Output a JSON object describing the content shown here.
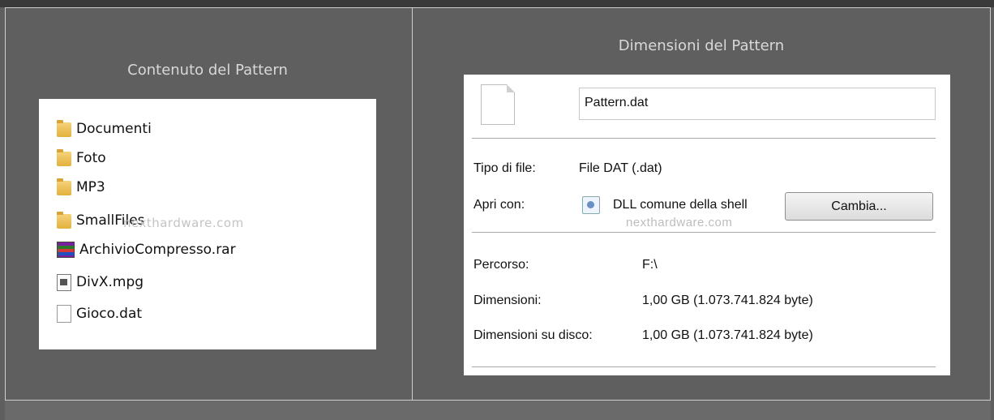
{
  "left_panel": {
    "title": "Contenuto del Pattern",
    "files": [
      {
        "name": "Documenti",
        "icon": "folder-icon"
      },
      {
        "name": "Foto",
        "icon": "folder-icon"
      },
      {
        "name": "MP3",
        "icon": "folder-icon"
      },
      {
        "name": "SmallFiles",
        "icon": "folder-icon"
      },
      {
        "name": "ArchivioCompresso.rar",
        "icon": "rar-archive-icon"
      },
      {
        "name": "DivX.mpg",
        "icon": "video-file-icon"
      },
      {
        "name": "Gioco.dat",
        "icon": "document-icon"
      }
    ],
    "watermark": "nexthardware.com"
  },
  "right_panel": {
    "title": "Dimensioni del Pattern",
    "file_name": "Pattern.dat",
    "type_label": "Tipo di file:",
    "type_value": "File DAT (.dat)",
    "open_with_label": "Apri con:",
    "open_with_value": "DLL comune della shell",
    "change_button": "Cambia...",
    "watermark": "nexthardware.com",
    "path_label": "Percorso:",
    "path_value": "F:\\",
    "size_label": "Dimensioni:",
    "size_value": "1,00 GB (1.073.741.824 byte)",
    "disk_size_label": "Dimensioni su disco:",
    "disk_size_value": "1,00 GB (1.073.741.824 byte)"
  },
  "colors": {
    "background": "#5f5f5f",
    "topbar": "#3a3a3a",
    "title_text": "#d8d8d8"
  }
}
